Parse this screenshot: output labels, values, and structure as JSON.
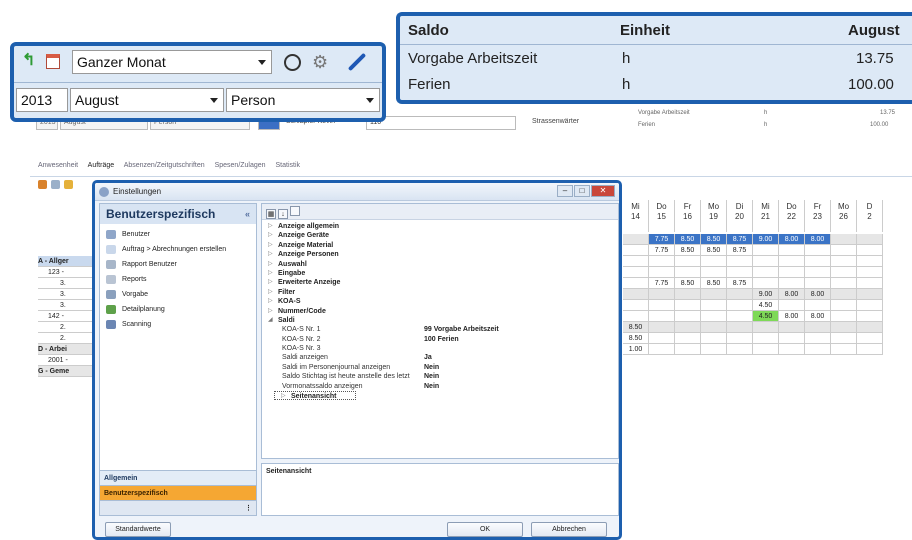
{
  "toolbar": {
    "period": "Ganzer Monat",
    "year": "2013",
    "month": "August",
    "dimension": "Person"
  },
  "background": {
    "top": {
      "month": "August",
      "dimension": "Person",
      "person": "Schläpfer Kevin",
      "person_no": "110",
      "role": "Strassenwärter",
      "saldo_rows": [
        {
          "label": "Vorgabe Arbeitszeit",
          "unit": "h",
          "value": "13.75"
        },
        {
          "label": "Ferien",
          "unit": "h",
          "value": "100.00"
        }
      ]
    },
    "tabs": [
      "Anwesenheit",
      "Aufträge",
      "Absenzen/Zeitgutschriften",
      "Spesen/Zulagen",
      "Statistik"
    ],
    "tree": [
      "A - Allger",
      "123 -",
      "3.",
      "3.",
      "3.",
      "142 -",
      "2.",
      "2.",
      "D - Arbei",
      "2001 -",
      "G - Geme"
    ],
    "days": [
      {
        "dow": "Mi",
        "day": "14"
      },
      {
        "dow": "Do",
        "day": "15"
      },
      {
        "dow": "Fr",
        "day": "16"
      },
      {
        "dow": "Mo",
        "day": "19"
      },
      {
        "dow": "Di",
        "day": "20"
      },
      {
        "dow": "Mi",
        "day": "21"
      },
      {
        "dow": "Do",
        "day": "22"
      },
      {
        "dow": "Fr",
        "day": "23"
      },
      {
        "dow": "Mo",
        "day": "26"
      },
      {
        "dow": "D",
        "day": "2"
      }
    ],
    "grid_rows": [
      [
        "",
        "7.75",
        "8.50",
        "8.50",
        "8.75",
        "9.00",
        "8.00",
        "8.00",
        "",
        ""
      ],
      [
        "",
        "7.75",
        "8.50",
        "8.50",
        "8.75",
        "",
        "",
        "",
        "",
        ""
      ],
      [
        "",
        "",
        "",
        "",
        "",
        "",
        "",
        "",
        "",
        ""
      ],
      [
        "",
        "",
        "",
        "",
        "",
        "",
        "",
        "",
        "",
        ""
      ],
      [
        "",
        "7.75",
        "8.50",
        "8.50",
        "8.75",
        "",
        "",
        "",
        "",
        ""
      ],
      [
        "",
        "",
        "",
        "",
        "",
        "9.00",
        "8.00",
        "8.00",
        "",
        ""
      ],
      [
        "",
        "",
        "",
        "",
        "",
        "4.50",
        "",
        "",
        "",
        ""
      ],
      [
        "",
        "",
        "",
        "",
        "",
        "4.50",
        "8.00",
        "8.00",
        "",
        ""
      ],
      [
        "8.50",
        "",
        "",
        "",
        "",
        "",
        "",
        "",
        "",
        ""
      ],
      [
        "8.50",
        "",
        "",
        "",
        "",
        "",
        "",
        "",
        "",
        ""
      ],
      [
        "1.00",
        "",
        "",
        "",
        "",
        "",
        "",
        "",
        "",
        ""
      ]
    ]
  },
  "saldo": {
    "headers": [
      "Saldo",
      "Einheit",
      "August"
    ],
    "rows": [
      {
        "label": "Vorgabe Arbeitszeit",
        "unit": "h",
        "value": "13.75"
      },
      {
        "label": "Ferien",
        "unit": "h",
        "value": "100.00"
      }
    ]
  },
  "dialog": {
    "title": "Einstellungen",
    "nav_title": "Benutzerspezifisch",
    "nav_items": [
      {
        "label": "Benutzer",
        "icon": "user-icon",
        "color": "#8fa6c9"
      },
      {
        "label": "Auftrag > Abrechnungen erstellen",
        "icon": "document-icon",
        "color": "#c9d7ea"
      },
      {
        "label": "Rapport Benutzer",
        "icon": "report-user-icon",
        "color": "#a7b6c9"
      },
      {
        "label": "Reports",
        "icon": "reports-icon",
        "color": "#b9c4d3"
      },
      {
        "label": "Vorgabe",
        "icon": "table-icon",
        "color": "#8aa0bd"
      },
      {
        "label": "Detailplanung",
        "icon": "planning-icon",
        "color": "#5ea14a"
      },
      {
        "label": "Scanning",
        "icon": "scanner-icon",
        "color": "#6b86b3"
      }
    ],
    "nav_groups": [
      "Allgemein",
      "Benutzerspezifisch"
    ],
    "properties": [
      {
        "key": "Anzeige allgemein",
        "type": "cat",
        "state": "collapsed"
      },
      {
        "key": "Anzeige Geräte",
        "type": "cat",
        "state": "collapsed"
      },
      {
        "key": "Anzeige Material",
        "type": "cat",
        "state": "collapsed"
      },
      {
        "key": "Anzeige Personen",
        "type": "cat",
        "state": "collapsed"
      },
      {
        "key": "Auswahl",
        "type": "cat",
        "state": "collapsed"
      },
      {
        "key": "Eingabe",
        "type": "cat",
        "state": "collapsed"
      },
      {
        "key": "Erweiterte Anzeige",
        "type": "cat",
        "state": "collapsed"
      },
      {
        "key": "Filter",
        "type": "cat",
        "state": "collapsed"
      },
      {
        "key": "KOA-S",
        "type": "cat",
        "state": "collapsed"
      },
      {
        "key": "Nummer/Code",
        "type": "cat",
        "state": "collapsed"
      },
      {
        "key": "Saldi",
        "type": "cat",
        "state": "expanded"
      },
      {
        "key": "KOA-S Nr. 1",
        "type": "sub",
        "value": "99 Vorgabe Arbeitszeit"
      },
      {
        "key": "KOA-S Nr. 2",
        "type": "sub",
        "value": "100 Ferien"
      },
      {
        "key": "KOA-S Nr. 3",
        "type": "sub",
        "value": ""
      },
      {
        "key": "Saldi anzeigen",
        "type": "sub",
        "value": "Ja"
      },
      {
        "key": "Saldi im Personenjournal anzeigen",
        "type": "sub",
        "value": "Nein"
      },
      {
        "key": "Saldo Stichtag ist heute anstelle des letzt",
        "type": "sub",
        "value": "Nein"
      },
      {
        "key": "Vormonatssaldo anzeigen",
        "type": "sub",
        "value": "Nein"
      },
      {
        "key": "Seitenansicht",
        "type": "cat",
        "state": "collapsed"
      }
    ],
    "description": "Seitenansicht",
    "buttons": {
      "defaults": "Standardwerte",
      "ok": "OK",
      "cancel": "Abbrechen"
    }
  },
  "colors": {
    "accent": "#1d5fae",
    "highlight": "#7ed957",
    "selected_group": "#f5a733"
  }
}
